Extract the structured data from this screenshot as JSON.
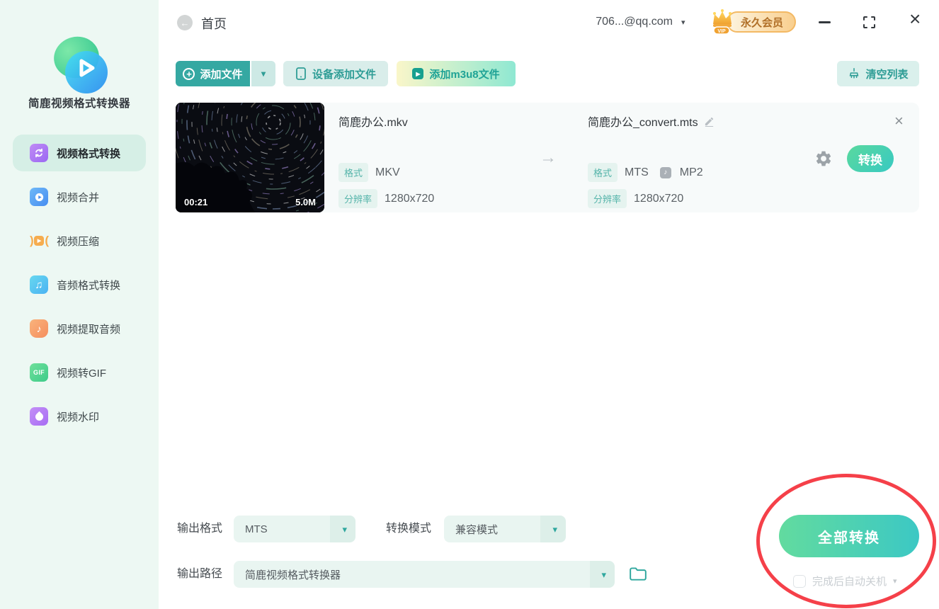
{
  "app": {
    "title": "简鹿视频格式转换器"
  },
  "header": {
    "back": "首页",
    "account": "706...@qq.com",
    "vip": "永久会员",
    "close_glyph": "×"
  },
  "sidebar": {
    "items": [
      {
        "label": "视频格式转换",
        "active": true
      },
      {
        "label": "视频合并",
        "active": false
      },
      {
        "label": "视频压缩",
        "active": false
      },
      {
        "label": "音频格式转换",
        "active": false
      },
      {
        "label": "视频提取音频",
        "active": false
      },
      {
        "label": "视频转GIF",
        "active": false
      },
      {
        "label": "视频水印",
        "active": false
      }
    ],
    "gif_icon_text": "GIF"
  },
  "toolbar": {
    "add_file": "添加文件",
    "add_from_device": "设备添加文件",
    "add_m3u8": "添加m3u8文件",
    "clear_list": "清空列表"
  },
  "file": {
    "duration": "00:21",
    "size": "5.0M",
    "source": {
      "name": "简鹿办公.mkv",
      "format_label": "格式",
      "format": "MKV",
      "resolution_label": "分辨率",
      "resolution": "1280x720"
    },
    "target": {
      "name": "简鹿办公_convert.mts",
      "format_label": "格式",
      "format": "MTS",
      "audio_format": "MP2",
      "resolution_label": "分辨率",
      "resolution": "1280x720",
      "convert_button": "转换"
    },
    "remove_glyph": "×"
  },
  "footer": {
    "output_format_label": "输出格式",
    "output_format_value": "MTS",
    "convert_mode_label": "转换模式",
    "convert_mode_value": "兼容模式",
    "output_path_label": "输出路径",
    "output_path_value": "简鹿视频格式转换器",
    "convert_all_button": "全部转换",
    "auto_shutdown_label": "完成后自动关机"
  },
  "colors": {
    "accent_teal": "#35a8a2",
    "convert_gradient_start": "#5ad99e",
    "convert_gradient_end": "#38c9c2",
    "sidebar_bg": "#edf8f3",
    "active_item_bg": "#d6efe6",
    "badge_bg": "#e5f3ef",
    "badge_text": "#55b4aa",
    "annotation_red": "#f54049",
    "vip_text": "#b06f28"
  }
}
